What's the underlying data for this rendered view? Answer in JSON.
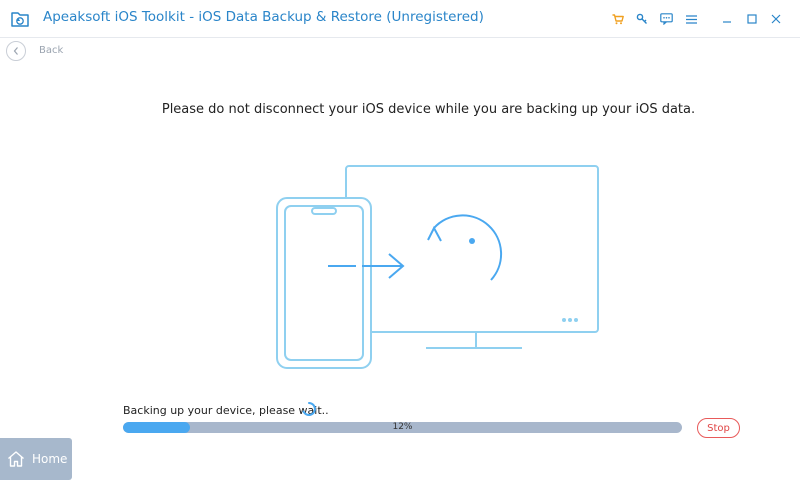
{
  "titlebar": {
    "title": "Apeaksoft iOS Toolkit - iOS Data Backup & Restore (Unregistered)",
    "icons": [
      "cart-icon",
      "key-icon",
      "feedback-icon",
      "menu-icon",
      "minimize-icon",
      "maximize-icon",
      "close-icon"
    ]
  },
  "nav": {
    "back_label": "Back"
  },
  "main": {
    "message": "Please do not disconnect your iOS device while you are backing up your iOS data."
  },
  "progress": {
    "label": "Backing up your device, please wait..",
    "percent": 12,
    "percent_text": "12%",
    "stop_label": "Stop"
  },
  "home": {
    "label": "Home"
  },
  "colors": {
    "accent": "#2a85c9",
    "illustration": "#8fd0f0",
    "progress_fill": "#4aa8f0",
    "progress_track": "#a8b7cc",
    "stop": "#e04545",
    "cart": "#f0a020"
  }
}
